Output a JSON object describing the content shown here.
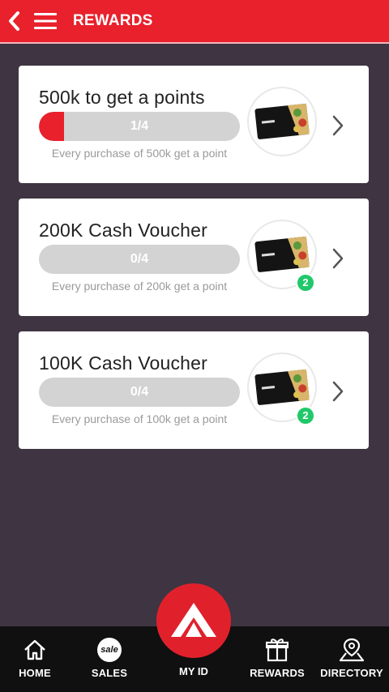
{
  "header": {
    "title": "REWARDS"
  },
  "rewards": [
    {
      "title": "500k to get a points",
      "progress_text": "1/4",
      "progress": 0.125,
      "description": "Every purchase of 500k get a point",
      "badge": ""
    },
    {
      "title": "200K Cash Voucher",
      "progress_text": "0/4",
      "progress": 0,
      "description": "Every purchase of 200k get a point",
      "badge": "2"
    },
    {
      "title": "100K Cash Voucher",
      "progress_text": "0/4",
      "progress": 0,
      "description": "Every purchase of 100k get a point",
      "badge": "2"
    }
  ],
  "nav": {
    "home": "HOME",
    "sales": "SALES",
    "sales_icon_text": "sale",
    "myid": "MY ID",
    "rewards": "REWARDS",
    "directory": "DIRECTORY"
  },
  "colors": {
    "brand": "#e8212c",
    "background": "#3f3442",
    "badge": "#20c86a",
    "nav": "#101010"
  },
  "icons": [
    "back-arrow-icon",
    "hamburger-menu-icon",
    "chevron-right-icon",
    "home-icon",
    "sale-icon",
    "logo-icon",
    "gift-icon",
    "location-pin-icon"
  ]
}
